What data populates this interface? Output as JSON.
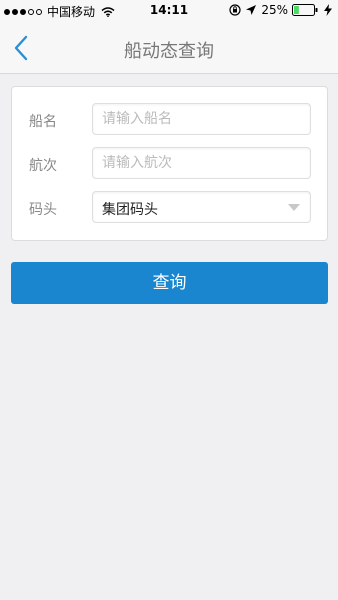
{
  "status_bar": {
    "carrier": "中国移动",
    "time": "14:11",
    "battery_percent": "25%",
    "signal_bars_filled": 3,
    "signal_bars_total": 5,
    "battery_level": 0.25,
    "icons": [
      "wifi-icon",
      "orientation-lock-icon",
      "location-arrow-icon",
      "battery-icon",
      "charging-icon"
    ]
  },
  "nav": {
    "title": "船动态查询",
    "back_icon": "chevron-left-icon"
  },
  "form": {
    "ship_name": {
      "label": "船名",
      "placeholder": "请输入船名",
      "value": ""
    },
    "voyage": {
      "label": "航次",
      "placeholder": "请输入航次",
      "value": ""
    },
    "terminal": {
      "label": "码头",
      "selected": "集团码头",
      "icon": "chevron-down-icon"
    }
  },
  "actions": {
    "query_label": "查询"
  },
  "colors": {
    "accent": "#1a86d0",
    "background": "#f0f0f2",
    "back_icon": "#2a8fd6"
  }
}
